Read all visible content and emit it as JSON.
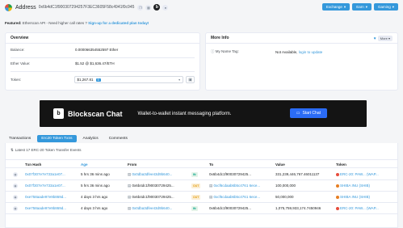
{
  "header": {
    "title": "Address",
    "address": "0x6b4dC1f900307294257F3EC3605F58c4941f0c945",
    "b_badge": "b",
    "buttons": [
      "Exchange",
      "Earn",
      "Gaming"
    ]
  },
  "featured": {
    "label": "Featured:",
    "text": "Etherscan API - Need higher call rates ?",
    "link": "Sign-up for a dedicated plan today!"
  },
  "overview": {
    "title": "Overview",
    "balance_label": "Balance:",
    "balance_value": "0.000066354552597 Ether",
    "ether_value_label": "Ether Value:",
    "ether_value": "$1.52 @ $1,636.47/ETH",
    "token_label": "Token:",
    "token_value": "$1,267.81",
    "token_count": "5"
  },
  "more_info": {
    "title": "More Info",
    "more_label": "More",
    "name_tag_label": "My Name Tag:",
    "name_tag_value": "Not Available,",
    "name_tag_link": "login to update"
  },
  "banner": {
    "logo_letter": "b",
    "name": "Blockscan Chat",
    "tagline": "Wallet-to-wallet instant messaging platform.",
    "button": "Start Chat"
  },
  "tabs": [
    "Transactions",
    "Erc20 Token Txns",
    "Analytics",
    "Comments"
  ],
  "active_tab": "Erc20 Token Txns",
  "table": {
    "latest_text": "Latest 17 ERC-20 Token Transfer Events",
    "columns": [
      "Txn Hash",
      "Age",
      "From",
      "To",
      "Value",
      "Token"
    ],
    "rows": [
      {
        "hash": "0x07f307e7e733a1e07...",
        "age": "5 hrs 36 mins ago",
        "from": "0x0dba3dfee43d9b640...",
        "dir": "IN",
        "to": "0x6b4dc1f90030729425...",
        "value": "331,239,446,767.46011137",
        "token": "ERC-20: PAW... (WAP...",
        "token_kind": "e"
      },
      {
        "hash": "0x07f307e7e733a1e07...",
        "age": "5 hrs 36 mins ago",
        "from": "0x6b4dc1f90030729425...",
        "dir": "OUT",
        "to": "0xcf6cdaab6b5c4761 6ece...",
        "value": "100,000,000",
        "token": "SHIBA INU (SHIB)",
        "token_kind": "s"
      },
      {
        "hash": "0xe758aade97e9b869d...",
        "age": "4 days 3 hrs ago",
        "from": "0x6b4dc1f90030729425...",
        "dir": "OUT",
        "to": "0xcf6cdaab6b5c4761 6ece...",
        "value": "50,000,000",
        "token": "SHIBA INU (SHIB)",
        "token_kind": "s"
      },
      {
        "hash": "0xe758aade97e9b869d...",
        "age": "4 days 3 hrs ago",
        "from": "0x0dba3dfee43d9b640...",
        "dir": "IN",
        "to": "0x6b4dc1f90030729425...",
        "value": "1,075,759,933,174.7450946",
        "token": "ERC-20: PAW... (WAP...",
        "token_kind": "e"
      }
    ]
  }
}
